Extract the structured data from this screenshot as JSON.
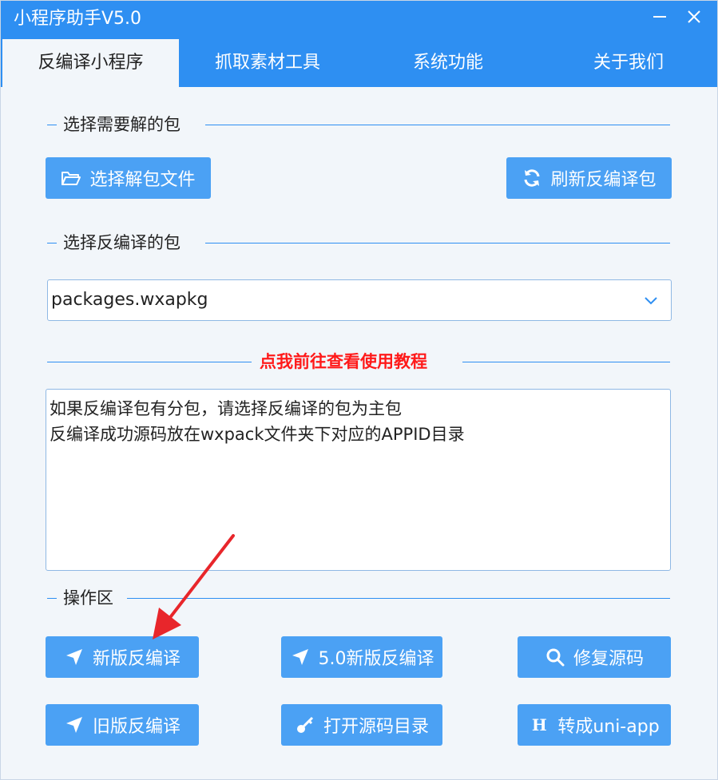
{
  "window": {
    "title": "小程序助手V5.0"
  },
  "tabs": [
    {
      "label": "反编译小程序",
      "active": true
    },
    {
      "label": "抓取素材工具",
      "active": false
    },
    {
      "label": "系统功能",
      "active": false
    },
    {
      "label": "关于我们",
      "active": false
    }
  ],
  "section_select_unpack": {
    "label": "选择需要解的包",
    "select_file_button": "选择解包文件",
    "refresh_button": "刷新反编译包"
  },
  "section_select_decompile": {
    "label": "选择反编译的包",
    "selected_package": "packages.wxapkg"
  },
  "tutorial_link": "点我前往查看使用教程",
  "info_text": {
    "line1": "如果反编译包有分包，请选择反编译的包为主包",
    "line2": "反编译成功源码放在wxpack文件夹下对应的APPID目录"
  },
  "operations": {
    "label": "操作区",
    "new_decompile": "新版反编译",
    "v5_decompile": "5.0新版反编译",
    "repair_source": "修复源码",
    "old_decompile": "旧版反编译",
    "open_source_dir": "打开源码目录",
    "to_uniapp": "转成uni-app",
    "to_uniapp_prefix": "H"
  },
  "colors": {
    "accent": "#2e8ff2",
    "button": "#4ba1f4",
    "link": "#ff1a1a",
    "annotation_arrow": "#e8262b"
  },
  "icons": {
    "minimize": "minimize-icon",
    "close": "close-icon",
    "folder": "folder-open-icon",
    "refresh": "refresh-icon",
    "chevron": "chevron-down-icon",
    "send": "send-icon",
    "search": "search-icon",
    "key": "key-icon"
  }
}
